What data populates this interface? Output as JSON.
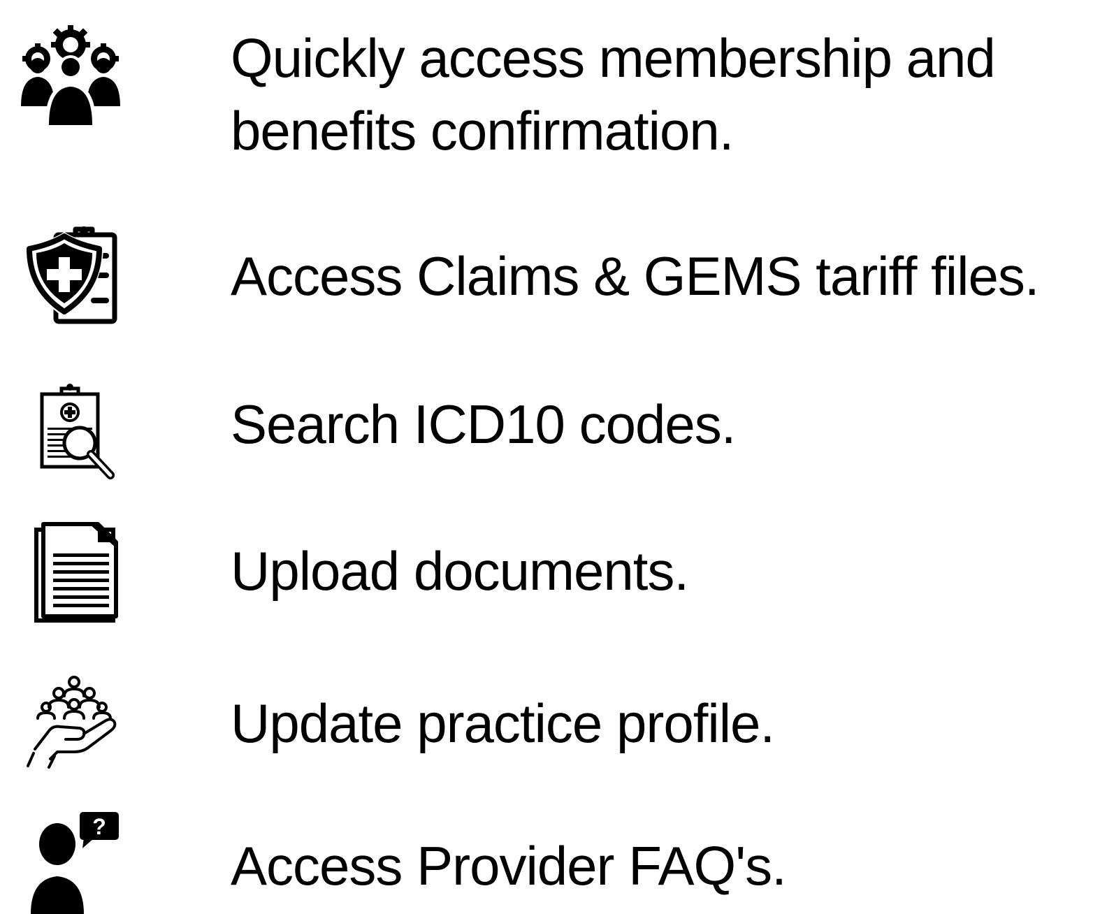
{
  "features": [
    {
      "icon": "people-gears-icon",
      "text_line1": "Quickly access membership and",
      "text_line2": "benefits confirmation."
    },
    {
      "icon": "shield-clipboard-icon",
      "text": "Access Claims & GEMS tariff files."
    },
    {
      "icon": "clipboard-search-icon",
      "text": "Search ICD10 codes."
    },
    {
      "icon": "documents-icon",
      "text": "Upload documents."
    },
    {
      "icon": "hand-people-icon",
      "text": "Update practice profile."
    },
    {
      "icon": "person-question-icon",
      "text": "Access Provider FAQ's."
    }
  ]
}
